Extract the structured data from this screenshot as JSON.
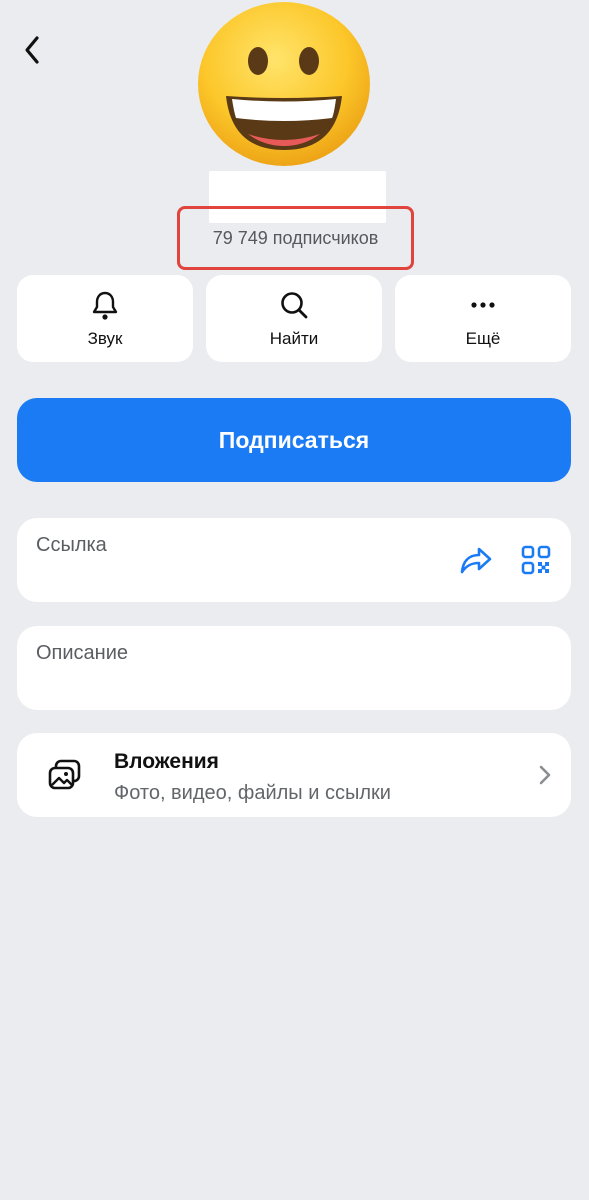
{
  "header": {
    "back_icon": "chevron-left-icon",
    "avatar_icon": "grinning-face-emoji"
  },
  "profile": {
    "subscribers": "79 749 подписчиков"
  },
  "actions": [
    {
      "label": "Звук",
      "icon": "bell-icon"
    },
    {
      "label": "Найти",
      "icon": "search-icon"
    },
    {
      "label": "Ещё",
      "icon": "more-horizontal-icon"
    }
  ],
  "subscribe_label": "Подписаться",
  "link_card": {
    "title": "Ссылка",
    "share_icon": "share-arrow-icon",
    "qr_icon": "qr-code-icon"
  },
  "description_card": {
    "title": "Описание"
  },
  "attachments": {
    "title": "Вложения",
    "subtitle": "Фото, видео, файлы и ссылки",
    "icon": "gallery-icon"
  },
  "colors": {
    "background": "#ebecf0",
    "accent": "#1b7bf5",
    "highlight": "#e0443c"
  }
}
